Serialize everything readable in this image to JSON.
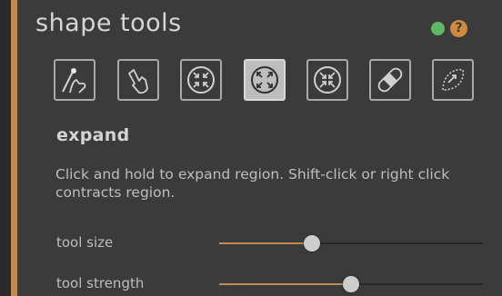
{
  "panel": {
    "title": "shape tools",
    "status_color": "#5fb865",
    "accent_color": "#c08a52",
    "help_icon": "?"
  },
  "toolbar": {
    "tools": [
      {
        "icon": "smooth-brush-hand-icon",
        "active": false
      },
      {
        "icon": "pointer-hand-icon",
        "active": false
      },
      {
        "icon": "shrink-arrows-icon",
        "active": false
      },
      {
        "icon": "expand-arrows-icon",
        "active": true
      },
      {
        "icon": "contract-arrows-icon",
        "active": false
      },
      {
        "icon": "bandage-icon",
        "active": false
      },
      {
        "icon": "lasso-shape-icon",
        "active": false
      }
    ]
  },
  "tool": {
    "name": "expand",
    "description": "Click and hold to expand region.  Shift-click or right click contracts region."
  },
  "sliders": [
    {
      "label": "tool size",
      "value": 0.35
    },
    {
      "label": "tool strength",
      "value": 0.5
    }
  ]
}
